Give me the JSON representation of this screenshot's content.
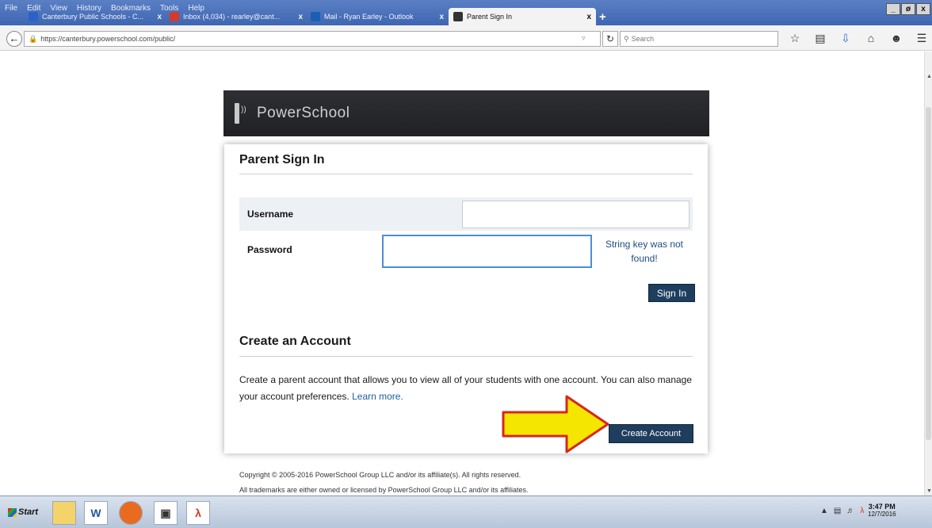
{
  "browser": {
    "menu": [
      "File",
      "Edit",
      "View",
      "History",
      "Bookmarks",
      "Tools",
      "Help"
    ],
    "window_controls": [
      "_",
      "ø",
      "x"
    ],
    "tabs": [
      {
        "title": "Canterbury Public Schools - C...",
        "close": "x",
        "icon_color": "#2a62c9"
      },
      {
        "title": "Inbox (4,034) - rearley@cant...",
        "close": "x",
        "icon_color": "#d23b2e"
      },
      {
        "title": "Mail - Ryan Earley - Outlook",
        "close": "x",
        "icon_color": "#1a5fb4"
      },
      {
        "title": "Parent Sign In",
        "close": "x",
        "icon_color": "#333333"
      }
    ],
    "new_tab": "+",
    "url": "https://canterbury.powerschool.com/public/",
    "search_placeholder": "Search",
    "nav_icons": [
      "star-icon",
      "bookmarks-icon",
      "download-icon",
      "home-icon",
      "chat-icon",
      "menu-icon"
    ]
  },
  "page": {
    "brand": "PowerSchool",
    "signin": {
      "title": "Parent Sign In",
      "username_label": "Username",
      "username_value": "",
      "password_label": "Password",
      "password_value": "",
      "error": "String key was not found!",
      "button": "Sign In"
    },
    "create": {
      "title": "Create an Account",
      "description": "Create a parent account that allows you to view all of your students with one account. You can also manage your account preferences.",
      "learn_more": "Learn more.",
      "button": "Create Account"
    },
    "footer": {
      "copyright": "Copyright © 2005-2016 PowerSchool Group LLC and/or its affiliate(s). All rights reserved.",
      "trademark": "All trademarks are either owned or licensed by PowerSchool Group LLC and/or its affiliates."
    },
    "annotation_arrow_color": "#f5e600"
  },
  "taskbar": {
    "start": "Start",
    "time": "3:47 PM",
    "date": "12/7/2016"
  }
}
